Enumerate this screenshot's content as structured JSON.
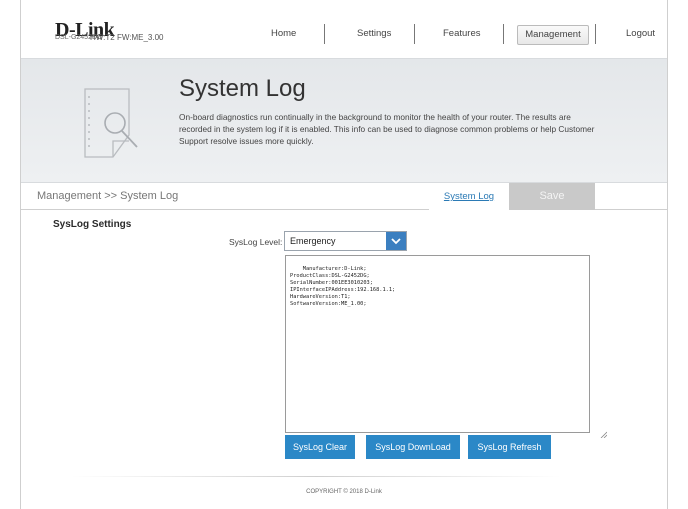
{
  "header": {
    "logo": "D-Link",
    "model": "DSL-G2452DG",
    "hw_fw": "HW:T2  FW:ME_3.00"
  },
  "nav": {
    "home": "Home",
    "settings": "Settings",
    "features": "Features",
    "management": "Management",
    "logout": "Logout"
  },
  "banner": {
    "title": "System Log",
    "description": "On-board diagnostics run continually in the background to monitor the health of your router. The results are recorded in the system log if it is enabled. This info can be used to diagnose common problems or help Customer Support resolve issues more quickly.",
    "icon": "document-search-icon"
  },
  "breadcrumb": "Management >> System Log",
  "tabs": {
    "system_log": "System Log",
    "save": "Save"
  },
  "section": {
    "title": "SysLog Settings",
    "level_label": "SysLog Level:",
    "level_value": "Emergency",
    "log_text": "Manufacturer:D-Link;\nProductClass:DSL-G2452DG;\nSerialNumber:001EE3010203;\nIPInterfaceIPAddress:192.168.1.1;\nHardwareVersion:T1;\nSoftwareVersion:ME_1.00;"
  },
  "buttons": {
    "clear": "SysLog Clear",
    "download": "SysLog DownLoad",
    "refresh": "SysLog Refresh"
  },
  "footer": {
    "copyright": "COPYRIGHT © 2018 D-Link"
  },
  "colors": {
    "accent": "#2b88c7",
    "link": "#2b7ab5",
    "save_disabled": "#c9c9c9"
  }
}
